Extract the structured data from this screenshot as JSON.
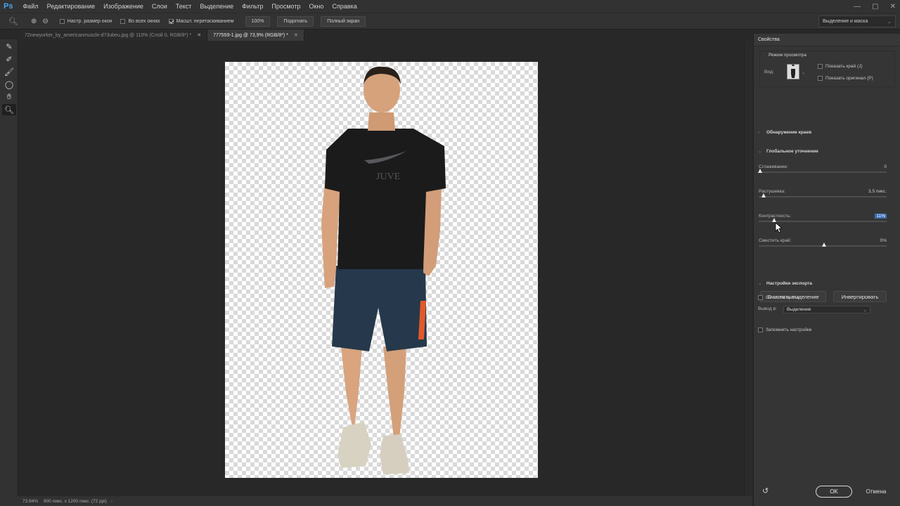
{
  "app": {
    "logo": "Ps"
  },
  "menu": [
    "Файл",
    "Редактирование",
    "Изображение",
    "Слои",
    "Текст",
    "Выделение",
    "Фильтр",
    "Просмотр",
    "Окно",
    "Справка"
  ],
  "window_controls": {
    "min": "—",
    "max": "▢",
    "close": "✕"
  },
  "options": {
    "resize_windows": "Настр. размер окон",
    "all_windows": "Во всех окнах",
    "scrubby_zoom": "Масшт. перетаскиванием",
    "btn_100": "100%",
    "btn_fit": "Подогнать",
    "btn_full": "Полный экран",
    "workspace": "Выделение и маска",
    "resize_windows_checked": false,
    "all_windows_checked": false,
    "scrubby_zoom_checked": true
  },
  "tabs": [
    {
      "label": "72newyorker_by_americanmuscle-d73ubeu.jpg @ 110% (Слой 0, RGB/8*) *",
      "active": false
    },
    {
      "label": "777559-1.jpg @ 73,9% (RGB/8*) *",
      "active": true
    }
  ],
  "tools": [
    "quick-selection",
    "refine-edge-brush",
    "brush",
    "lasso",
    "hand",
    "zoom"
  ],
  "status": {
    "zoom": "73.94%",
    "doc_size": "900 пикс. x 1200 пикс. (72 ppi)"
  },
  "figure": {
    "shirt_text": "JUVE"
  },
  "panel": {
    "title": "Свойства",
    "view_mode_title": "Режим просмотра",
    "view_label": "Вид:",
    "show_edge": "Показать край (J)",
    "show_original": "Показать оригинал (P)",
    "edge_detection": "Обнаружение краев",
    "global_refinement": "Глобальное уточнение",
    "smooth_label": "Сглаживание:",
    "smooth_value": "0",
    "smooth_level": 0,
    "feather_label": "Растушевка:",
    "feather_value": "3,5 пикс.",
    "feather_level": 0.03,
    "contrast_label": "Контрастность:",
    "contrast_value": "11%",
    "contrast_level": 0.11,
    "shift_edge_label": "Сместить край:",
    "shift_edge_value": "0%",
    "shift_edge_level": 0.5,
    "clear_selection": "Очистить выделение",
    "invert": "Инвертировать",
    "output_settings": "Настройки экспорта",
    "decontaminate": "Очистить цвета",
    "output_to_label": "Вывод в:",
    "output_to_value": "Выделение",
    "remember": "Запомнить настройки",
    "ok": "OK",
    "cancel": "Отмена"
  }
}
